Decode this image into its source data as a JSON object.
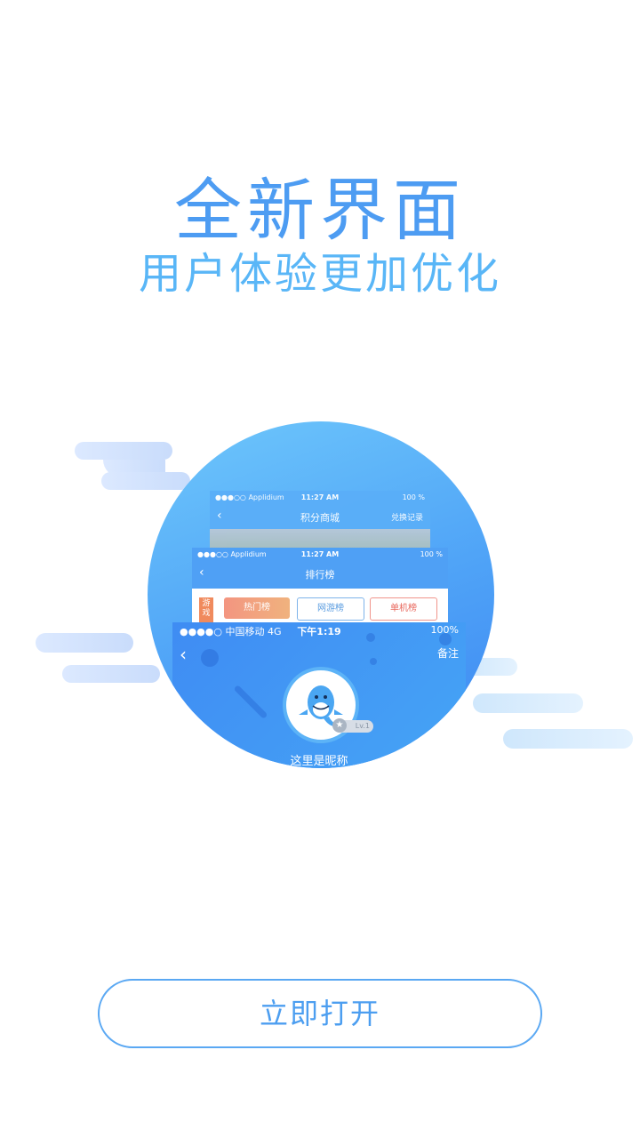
{
  "header": {
    "title": "全新界面",
    "subtitle": "用户体验更加优化"
  },
  "mockup": {
    "screen_mall": {
      "status_left": "●●●○○ Applidium",
      "status_time": "11:27 AM",
      "status_right": "100 %",
      "nav_title": "积分商城",
      "nav_action": "兑换记录"
    },
    "screen_rank": {
      "status_left": "●●●○○ Applidium",
      "status_time": "11:27 AM",
      "status_right": "100 %",
      "nav_title": "排行榜",
      "tag": "游戏",
      "tabs": [
        "热门榜",
        "网游榜",
        "单机榜"
      ]
    },
    "screen_profile": {
      "status_left": "●●●●○ 中国移动 4G",
      "status_time": "下午1:19",
      "status_right": "100%",
      "nav_action": "备注",
      "level": "Lv.1",
      "nickname": "这里是昵称"
    }
  },
  "cta": {
    "label": "立即打开"
  },
  "colors": {
    "accent": "#4d9cf2",
    "button_border": "#5aa8f3"
  }
}
